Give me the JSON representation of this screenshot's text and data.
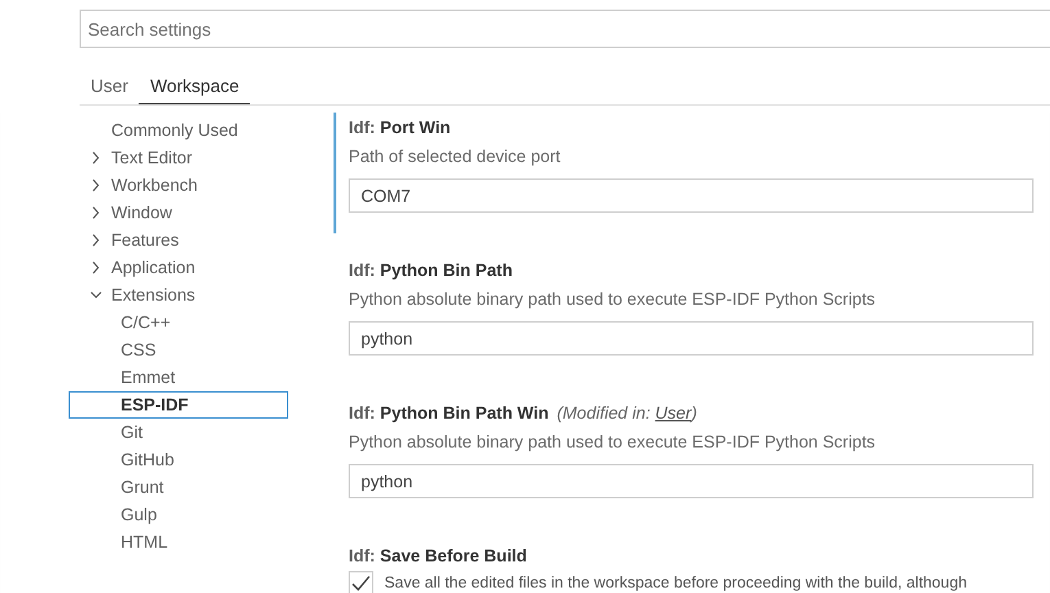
{
  "search": {
    "placeholder": "Search settings"
  },
  "tabs": [
    {
      "label": "User",
      "selected": false
    },
    {
      "label": "Workspace",
      "selected": true
    }
  ],
  "tree": [
    {
      "label": "Commonly Used",
      "kind": "leaf",
      "selected": false
    },
    {
      "label": "Text Editor",
      "kind": "group",
      "expanded": false,
      "selected": false
    },
    {
      "label": "Workbench",
      "kind": "group",
      "expanded": false,
      "selected": false
    },
    {
      "label": "Window",
      "kind": "group",
      "expanded": false,
      "selected": false
    },
    {
      "label": "Features",
      "kind": "group",
      "expanded": false,
      "selected": false
    },
    {
      "label": "Application",
      "kind": "group",
      "expanded": false,
      "selected": false
    },
    {
      "label": "Extensions",
      "kind": "group",
      "expanded": true,
      "selected": false,
      "children": [
        {
          "label": "C/C++",
          "selected": false
        },
        {
          "label": "CSS",
          "selected": false
        },
        {
          "label": "Emmet",
          "selected": false
        },
        {
          "label": "ESP-IDF",
          "selected": true
        },
        {
          "label": "Git",
          "selected": false
        },
        {
          "label": "GitHub",
          "selected": false
        },
        {
          "label": "Grunt",
          "selected": false
        },
        {
          "label": "Gulp",
          "selected": false
        },
        {
          "label": "HTML",
          "selected": false
        }
      ]
    }
  ],
  "settings": [
    {
      "kind": "text",
      "category": "Idf:",
      "name": "Port Win",
      "focused": true,
      "description": "Path of selected device port",
      "value": "COM7"
    },
    {
      "kind": "text",
      "category": "Idf:",
      "name": "Python Bin Path",
      "focused": false,
      "description": "Python absolute binary path used to execute ESP-IDF Python Scripts",
      "value": "python"
    },
    {
      "kind": "text",
      "category": "Idf:",
      "name": "Python Bin Path Win",
      "focused": false,
      "modified": {
        "prefix": "(Modified in:",
        "link": "User",
        "suffix": ")"
      },
      "description": "Python absolute binary path used to execute ESP-IDF Python Scripts",
      "value": "python"
    },
    {
      "kind": "checkbox",
      "category": "Idf:",
      "name": "Save Before Build",
      "focused": false,
      "checked": true,
      "description": "Save all the edited files in the workspace before proceeding with the build, although"
    }
  ]
}
